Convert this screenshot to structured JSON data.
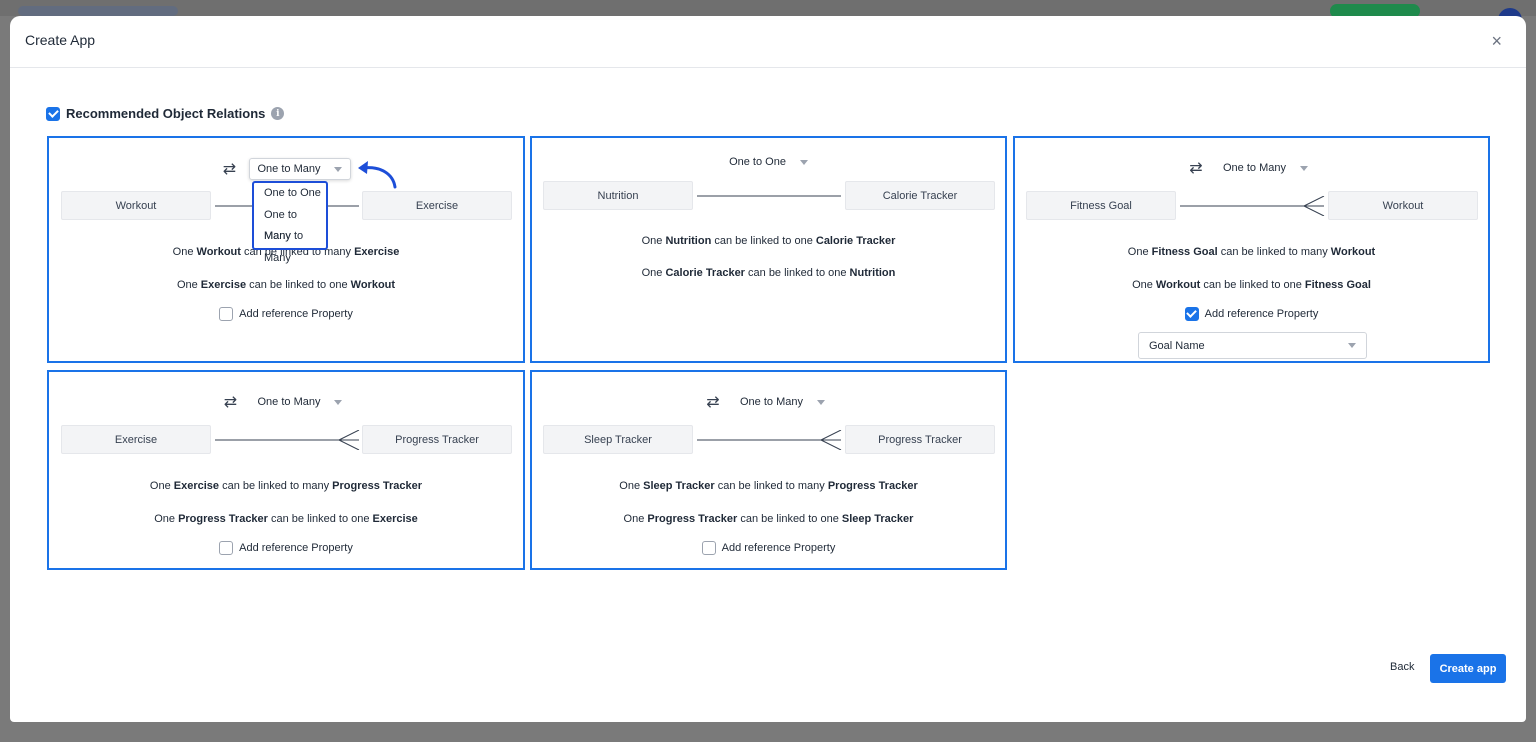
{
  "modal": {
    "title": "Create App",
    "close_glyph": "×"
  },
  "section": {
    "label": "Recommended Object Relations",
    "checked": true,
    "info_glyph": "i"
  },
  "swap_glyph": "⇄",
  "dropdown_options": [
    "One to One",
    "One to Many",
    "Many to Many"
  ],
  "cards": [
    {
      "relation": "One to Many",
      "left": "Workout",
      "right": "Exercise",
      "line1": {
        "a": "One ",
        "b": "Workout",
        "c": " can be linked to many ",
        "d": "Exercise"
      },
      "line2": {
        "a": "One ",
        "b": "Exercise",
        "c": " can be linked to one ",
        "d": "Workout"
      },
      "ref_label": "Add reference Property",
      "ref_checked": false
    },
    {
      "relation": "One to One",
      "left": "Nutrition",
      "right": "Calorie Tracker",
      "line1": {
        "a": "One ",
        "b": "Nutrition",
        "c": " can be linked to one ",
        "d": "Calorie Tracker"
      },
      "line2": {
        "a": "One ",
        "b": "Calorie Tracker",
        "c": " can be linked to one ",
        "d": "Nutrition"
      }
    },
    {
      "relation": "One to Many",
      "left": "Fitness Goal",
      "right": "Workout",
      "line1": {
        "a": "One ",
        "b": "Fitness Goal",
        "c": " can be linked to many ",
        "d": "Workout"
      },
      "line2": {
        "a": "One ",
        "b": "Workout",
        "c": " can be linked to one ",
        "d": "Fitness Goal"
      },
      "ref_label": "Add reference Property",
      "ref_checked": true,
      "property_value": "Goal Name"
    },
    {
      "relation": "One to Many",
      "left": "Exercise",
      "right": "Progress Tracker",
      "line1": {
        "a": "One ",
        "b": "Exercise",
        "c": " can be linked to many ",
        "d": "Progress Tracker"
      },
      "line2": {
        "a": "One ",
        "b": "Progress Tracker",
        "c": " can be linked to one ",
        "d": "Exercise"
      },
      "ref_label": "Add reference Property",
      "ref_checked": false
    },
    {
      "relation": "One to Many",
      "left": "Sleep Tracker",
      "right": "Progress Tracker",
      "line1": {
        "a": "One ",
        "b": "Sleep Tracker",
        "c": " can be linked to many ",
        "d": "Progress Tracker"
      },
      "line2": {
        "a": "One ",
        "b": "Progress Tracker",
        "c": " can be linked to one ",
        "d": "Sleep Tracker"
      },
      "ref_label": "Add reference Property",
      "ref_checked": false
    }
  ],
  "footer": {
    "back_label": "Back",
    "create_label": "Create app"
  },
  "colors": {
    "accent": "#1a73e8",
    "card_border": "#1a73e8",
    "annotation": "#1d4ed8"
  }
}
